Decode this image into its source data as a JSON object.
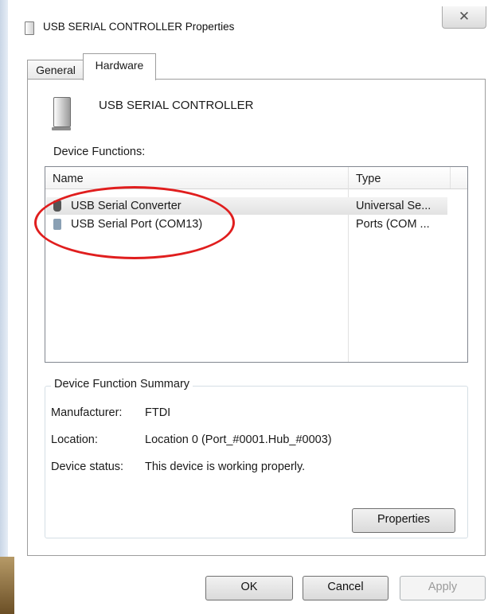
{
  "window": {
    "title": "USB SERIAL CONTROLLER Properties",
    "close_glyph": "✕"
  },
  "tabs": [
    {
      "label": "General",
      "active": false
    },
    {
      "label": "Hardware",
      "active": true
    }
  ],
  "device": {
    "name": "USB SERIAL CONTROLLER",
    "icon": "device-tower-icon"
  },
  "functions": {
    "label": "Device Functions:",
    "columns": [
      "Name",
      "Type"
    ],
    "rows": [
      {
        "name": "USB Serial Converter",
        "type": "Universal Se...",
        "icon": "usb-plug-icon",
        "selected": true
      },
      {
        "name": "USB Serial Port (COM13)",
        "type": "Ports (COM ...",
        "icon": "serial-port-icon",
        "selected": false
      }
    ]
  },
  "summary": {
    "legend": "Device Function Summary",
    "manufacturer_label": "Manufacturer:",
    "manufacturer_value": "FTDI",
    "location_label": "Location:",
    "location_value": "Location 0 (Port_#0001.Hub_#0003)",
    "status_label": "Device status:",
    "status_value": "This device is working properly."
  },
  "buttons": {
    "properties": "Properties",
    "ok": "OK",
    "cancel": "Cancel",
    "apply": "Apply"
  },
  "annotation": {
    "color": "#e01e1e"
  }
}
